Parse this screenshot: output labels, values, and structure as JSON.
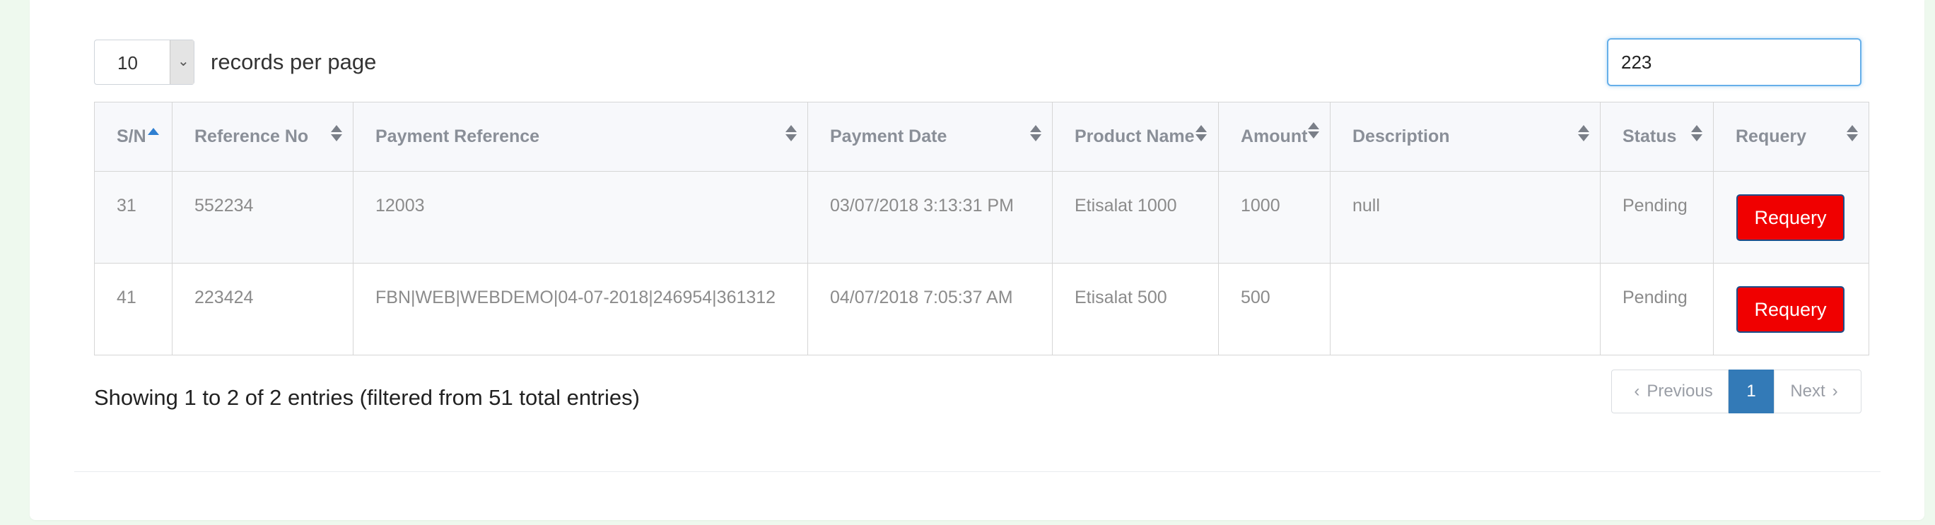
{
  "length_menu": {
    "value": "10",
    "label": "records per page"
  },
  "search": {
    "value": "223"
  },
  "table": {
    "columns": [
      "S/N",
      "Reference No",
      "Payment Reference",
      "Payment Date",
      "Product Name",
      "Amount",
      "Description",
      "Status",
      "Requery"
    ],
    "rows": [
      {
        "sn": "31",
        "reference_no": "552234",
        "payment_reference": "12003",
        "payment_date": "03/07/2018 3:13:31 PM",
        "product_name": "Etisalat 1000",
        "amount": "1000",
        "description": "null",
        "status": "Pending",
        "requery_label": "Requery"
      },
      {
        "sn": "41",
        "reference_no": "223424",
        "payment_reference": "FBN|WEB|WEBDEMO|04-07-2018|246954|361312",
        "payment_date": "04/07/2018 7:05:37 AM",
        "product_name": "Etisalat 500",
        "amount": "500",
        "description": "",
        "status": "Pending",
        "requery_label": "Requery"
      }
    ]
  },
  "footer": {
    "info": "Showing 1 to 2 of 2 entries (filtered from 51 total entries)"
  },
  "pagination": {
    "previous": "Previous",
    "current": "1",
    "next": "Next"
  },
  "colors": {
    "requery_button": "#f00000",
    "active_page": "#337ab7",
    "focus_border": "#66afe9",
    "page_background": "#eef9ee"
  }
}
